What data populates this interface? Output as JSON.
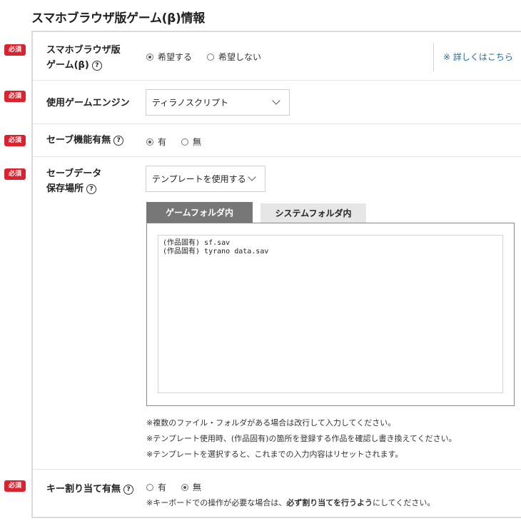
{
  "page_title": "スマホブラウザ版ゲーム(β)情報",
  "required_badge": "必須",
  "help_icon_glyph": "?",
  "rows": {
    "smartphone": {
      "label_line1": "スマホブラウザ版",
      "label_line2": "ゲーム(β)",
      "option_yes": "希望する",
      "option_no": "希望しない",
      "selected": "希望する",
      "details_link": "※ 詳しくはこちら"
    },
    "engine": {
      "label": "使用ゲームエンジン",
      "selected_value": "ティラノスクリプト"
    },
    "save": {
      "label": "セーブ機能有無",
      "option_yes": "有",
      "option_no": "無",
      "selected": "有"
    },
    "save_location": {
      "label_line1": "セーブデータ",
      "label_line2": "保存場所",
      "template_select": "テンプレートを使用する",
      "tabs": [
        "ゲームフォルダ内",
        "システムフォルダ内"
      ],
      "active_tab": "ゲームフォルダ内",
      "textarea_line1": "(作品固有) sf.sav",
      "textarea_line2": "(作品固有) tyrano data.sav",
      "notes": [
        "※複数のファイル・フォルダがある場合は改行して入力してください。",
        "※テンプレート使用時、(作品固有)の箇所を登録する作品を確認し書き換えてください。",
        "※テンプレートを選択すると、これまでの入力内容はリセットされます。"
      ]
    },
    "key_assign": {
      "label": "キー割り当て有無",
      "option_yes": "有",
      "option_no": "無",
      "selected": "無",
      "note_prefix": "※キーボードでの操作が必要な場合は、",
      "note_bold": "必ず割り当てを行うよう",
      "note_suffix": "にしてください。"
    }
  },
  "colors": {
    "required_badge": "#d9232e",
    "active_tab": "#777777",
    "inactive_tab": "#e6e6e6",
    "link": "#1f6e9c"
  }
}
